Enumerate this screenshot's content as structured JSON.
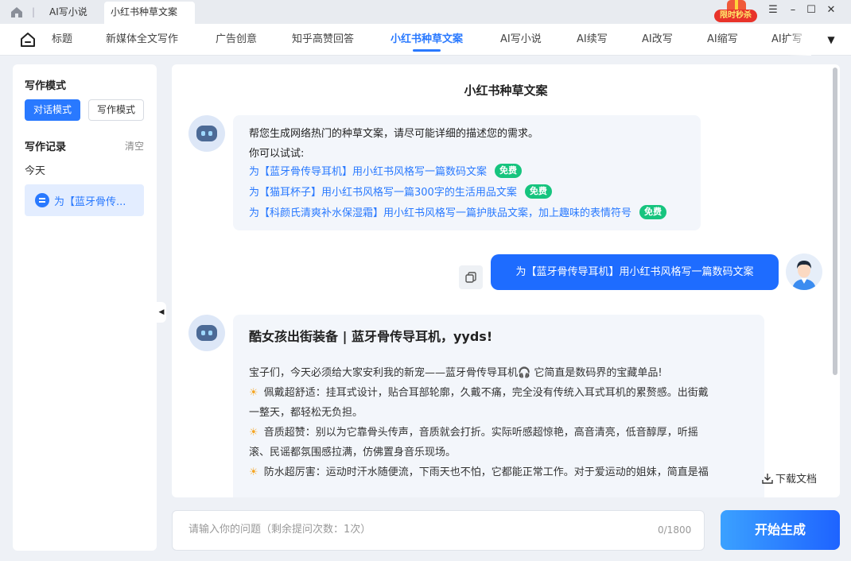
{
  "window": {
    "tabs": [
      {
        "label": "AI写小说",
        "close": "×"
      },
      {
        "label": "小红书种草文案",
        "close": "×"
      }
    ],
    "separator": "|",
    "promo": "限时秒杀",
    "controls": {
      "menu": "☰",
      "minimize": "–",
      "maximize": "☐",
      "close": "✕"
    }
  },
  "nav": {
    "items": [
      "标题",
      "新媒体全文写作",
      "广告创意",
      "知乎高赞回答",
      "小红书种草文案",
      "AI写小说",
      "AI续写",
      "AI改写",
      "AI缩写",
      "AI扩写"
    ],
    "active": "小红书种草文案",
    "more_icon": "▼"
  },
  "sidebar": {
    "mode_title": "写作模式",
    "modes": [
      "对话模式",
      "写作模式"
    ],
    "active_mode": "对话模式",
    "records_title": "写作记录",
    "clear": "清空",
    "today": "今天",
    "record_item": "为【蓝牙骨传..."
  },
  "collapse_icon": "◀",
  "chat": {
    "title": "小红书种草文案",
    "intro": "帮您生成网络热门的种草文案，请尽可能详细的描述您的需求。",
    "try_label": "你可以试试:",
    "suggestions": [
      {
        "text": "为【蓝牙骨传导耳机】用小红书风格写一篇数码文案",
        "badge": "免费"
      },
      {
        "text": "为【猫耳杯子】用小红书风格写一篇300字的生活用品文案",
        "badge": "免费"
      },
      {
        "text": "为【科颜氏清爽补水保湿霜】用小红书风格写一篇护肤品文案，加上趣味的表情符号",
        "badge": "免费"
      }
    ],
    "user_message": "为【蓝牙骨传导耳机】用小红书风格写一篇数码文案",
    "answer": {
      "title": "酷女孩出街装备 | 蓝牙骨传导耳机，yyds!",
      "lines": [
        "宝子们，今天必须给大家安利我的新宠——蓝牙骨传导耳机🎧 它简直是数码界的宝藏单品!",
        "☀ 佩戴超舒适：挂耳式设计，贴合耳部轮廓，久戴不痛，完全没有传统入耳式耳机的累赘感。出街戴",
        "一整天，都轻松无负担。",
        "☀ 音质超赞：别以为它靠骨头传声，音质就会打折。实际听感超惊艳，高音清亮，低音醇厚，听摇",
        "滚、民谣都氛围感拉满，仿佛置身音乐现场。",
        "☀ 防水超厉害：运动时汗水随便流，下雨天也不怕，它都能正常工作。对于爱运动的姐妹，简直是福"
      ]
    },
    "download": "下载文档"
  },
  "input": {
    "placeholder": "请输入你的问题（剩余提问次数：1次）",
    "value": "",
    "counter": "0/1800"
  },
  "generate_button": "开始生成"
}
